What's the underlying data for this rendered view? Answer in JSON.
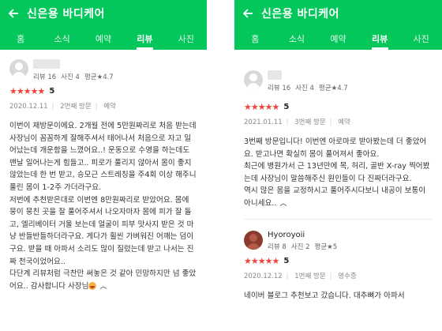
{
  "header": {
    "title": "신은용 바디케어"
  },
  "tabs": [
    "홈",
    "소식",
    "예약",
    "리뷰",
    "사진"
  ],
  "left_review": {
    "stats": {
      "reviews": "리뷰 16",
      "photos": "사진 4",
      "avg": "평균★4.7"
    },
    "stars": "★★★★★",
    "score": "5",
    "date": "2020.12.11",
    "visit": "2번째 방문",
    "method": "예약",
    "text": "이번이 재방문이에요. 2개월 전에 5만원짜리로 처음 받는데 사장님이 꼼꼼하게 잘해주셔서 태어나서 처음으로 자고 일어났는데 개운함을 느꼈어요..! 운동으로 수영을 하는데도 맨날 일어나는게 힘들고.. 피로가 풀리지 않아서 몸이 좋지 않았는데 한 번 받고, 승모근 스트레칭을 주4회 이상 해주니 풀린 몸이 1-2주 가더라구요.\n저번에 추천받은대로 이번엔 8만원짜리로 받았어요. 몸에 뭉이 뭉친 곳을 잘 풀어주셔서 나오자마자 몸에 피가 잘 돌고, 엘리베이터 거울 보는데 얼굴이 피부 맛사지 받은 것 마냥 반들반들하더라구요. 게다가 휠씬 가벼워진 어깨는 덤이구요. 받을 때 아파서 소리도 많이 질렀는데 받고 나서는 진짜 천국이었어요..\n다단계 리뷰처럼 극찬만 써놓은 것 같아 민망하지만 넘 좋았어요.. 감사합니다 사장님"
  },
  "right_review1": {
    "stats": {
      "reviews": "리뷰 16",
      "photos": "사진 4",
      "avg": "평균★4.7"
    },
    "stars": "★★★★★",
    "score": "5",
    "date": "2021.01.11",
    "visit": "3번째 방문",
    "method": "예약",
    "text": "3번째 방문입니다! 이번엔 아로마로 받아봤는데 더 좋았어요. 받고나면 확실히 몸이 풀어져서 좋아요.\n최근에 병원가서 근 13년만에 목, 허리, 골반 X-ray 찍어봤는데 사장님이 말씀해주신 원인들이 다 진짜더라구요.\n역시 많은 몸을 교정하시고 풀어주시다보니 내공이 보통이 아니세요.."
  },
  "right_review2": {
    "username": "Hyoroyoii",
    "stats": {
      "reviews": "리뷰 8",
      "photos": "사진 2",
      "avg": "평균★5"
    },
    "stars": "★★★★★",
    "score": "5",
    "date": "2020.12.12",
    "visit": "1번째 방문",
    "method": "영수증",
    "text": "네이버 블로그 추천보고 갔습니다. 대추뼈가 아파서"
  }
}
